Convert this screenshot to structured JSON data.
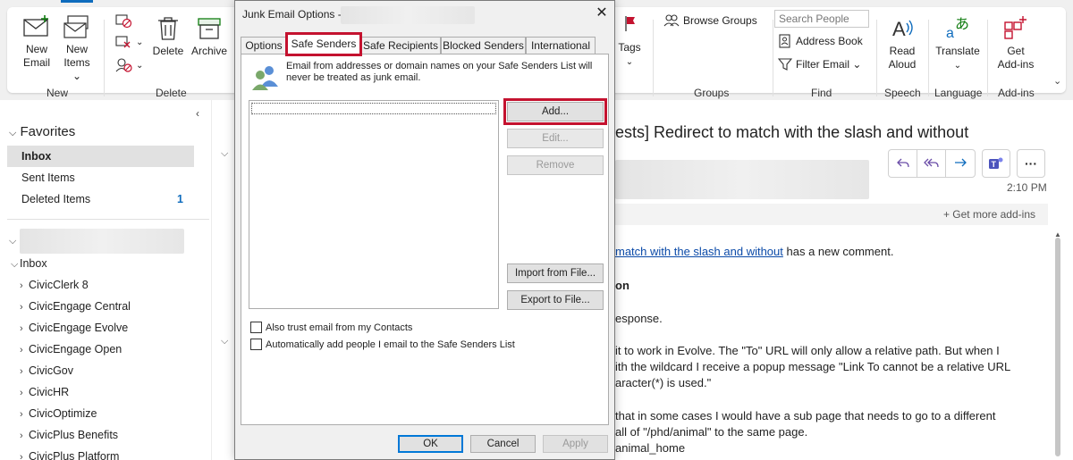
{
  "ribbon": {
    "new_email": "New\nEmail",
    "new_items": "New\nItems ⌄",
    "delete": "Delete",
    "archive": "Archive",
    "tags": "Tags",
    "tags_caret": "⌄",
    "browse_groups": "Browse Groups",
    "search_people_placeholder": "Search People",
    "address_book": "Address Book",
    "filter_email": "Filter Email ⌄",
    "read_aloud": "Read\nAloud",
    "translate": "Translate",
    "translate_caret": "⌄",
    "get_addins": "Get\nAdd-ins",
    "groups": {
      "new": "New",
      "delete": "Delete",
      "groups": "Groups",
      "find": "Find",
      "speech": "Speech",
      "language": "Language",
      "addins": "Add-ins"
    }
  },
  "folder_pane": {
    "favorites_label": "Favorites",
    "favorites": [
      {
        "label": "Inbox",
        "selected": true
      },
      {
        "label": "Sent Items"
      },
      {
        "label": "Deleted Items",
        "count": "1"
      }
    ],
    "inbox_label": "Inbox",
    "subfolders": [
      "CivicClerk 8",
      "CivicEngage Central",
      "CivicEngage Evolve",
      "CivicEngage Open",
      "CivicGov",
      "CivicHR",
      "CivicOptimize",
      "CivicPlus Benefits",
      "CivicPlus Platform"
    ]
  },
  "reading_pane": {
    "subject": "ests] Redirect to match with the slash and without",
    "time": "2:10 PM",
    "get_addins": "Get more add-ins",
    "body": {
      "line1_link": "match with the slash and without",
      "line1_rest": " has a new comment.",
      "line2": "on",
      "line3": "esponse.",
      "line4": "it to work in Evolve.  The \"To\" URL will only allow a relative path.  But when I",
      "line5": "ith the wildcard I receive a popup message \"Link To cannot be a relative URL",
      "line6": "aracter(*) is used.\"",
      "line7": "that in some cases I would have a sub page that needs to go to a different",
      "line8": "all of \"/phd/animal\" to the same page.",
      "line9": "animal_home"
    }
  },
  "dialog": {
    "title": "Junk Email Options -",
    "close": "✕",
    "tabs": [
      "Options",
      "Safe Senders",
      "Safe Recipients",
      "Blocked Senders",
      "International"
    ],
    "active_tab": "Safe Senders",
    "info_text": "Email from addresses or domain names on your Safe Senders List will never be treated as junk email.",
    "buttons": {
      "add": "Add...",
      "edit": "Edit...",
      "remove": "Remove",
      "import": "Import from File...",
      "export": "Export to File..."
    },
    "checkboxes": {
      "trust_contacts": "Also trust email from my Contacts",
      "auto_add": "Automatically add people I email to the Safe Senders List"
    },
    "footer": {
      "ok": "OK",
      "cancel": "Cancel",
      "apply": "Apply"
    }
  },
  "colors": {
    "accent": "#0f6cbd",
    "highlight": "#c4122f"
  }
}
